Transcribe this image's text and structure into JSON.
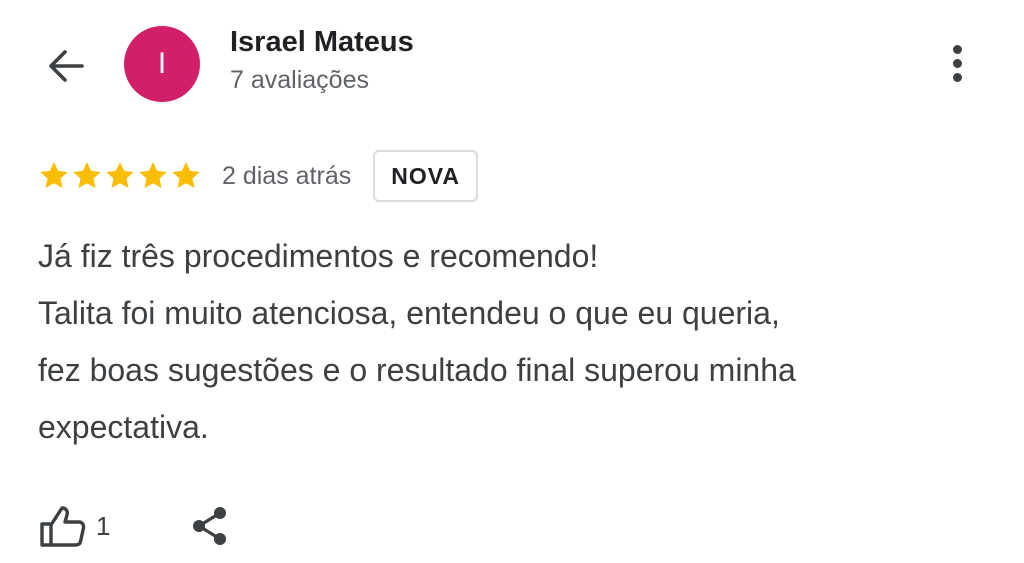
{
  "header": {
    "back_icon": "arrow-back-icon",
    "avatar": {
      "initial": "I",
      "color": "#d21f69"
    },
    "reviewer_name": "Israel Mateus",
    "review_count": "7 avaliações",
    "more_icon": "more-vertical-icon"
  },
  "review": {
    "rating": 5,
    "max_rating": 5,
    "star_color": "#fbbc04",
    "date": "2 dias atrás",
    "badge": "NOVA",
    "lines": [
      "Já fiz três procedimentos e recomendo!",
      "Talita foi muito atenciosa, entendeu o que eu queria,",
      "fez boas sugestões e o resultado final superou minha",
      "expectativa."
    ]
  },
  "actions": {
    "like_icon": "thumbs-up-icon",
    "like_count": "1",
    "share_icon": "share-icon"
  }
}
